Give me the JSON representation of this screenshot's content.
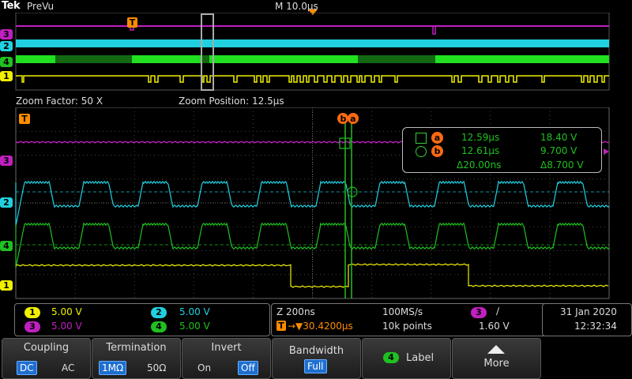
{
  "header": {
    "logo": "Tek",
    "mode": "PreVu",
    "horizontal_scale": "M 10.0µs"
  },
  "overview": {
    "channel_markers": [
      "3",
      "2",
      "4",
      "1"
    ],
    "trigger_marker": "T"
  },
  "zoom": {
    "factor_label": "Zoom Factor: 50 X",
    "position_label": "Zoom Position: 12.5µs"
  },
  "main": {
    "trigger_marker": "T",
    "cursor_tag": "ba",
    "channel_markers": [
      "3",
      "2",
      "4",
      "1"
    ]
  },
  "cursor_readout": {
    "a_badge": "a",
    "b_badge": "b",
    "a_time": "12.59µs",
    "a_value": "18.40 V",
    "b_time": "12.61µs",
    "b_value": "9.700 V",
    "delta_time": "Δ20.00ns",
    "delta_value": "Δ8.700 V"
  },
  "channels": [
    {
      "id": "1",
      "scale": "5.00 V",
      "color": "#f0f000"
    },
    {
      "id": "2",
      "scale": "5.00 V",
      "color": "#20d0e0"
    },
    {
      "id": "3",
      "scale": "5.00 V",
      "color": "#c020c0"
    },
    {
      "id": "4",
      "scale": "5.00 V",
      "color": "#20c020"
    }
  ],
  "acquisition": {
    "zoom_timebase": "Z 200ns",
    "trigger_position": "→▼30.4200µs",
    "sample_rate": "100MS/s",
    "record_length": "10k points",
    "trigger_channel": "3",
    "trigger_slope": "∕",
    "trigger_level": "1.60 V"
  },
  "datetime": {
    "date": "31 Jan  2020",
    "time": "12:32:34"
  },
  "softkeys": {
    "coupling": {
      "title": "Coupling",
      "opt1": "DC",
      "opt2": "AC"
    },
    "termination": {
      "title": "Termination",
      "opt1": "1MΩ",
      "opt2": "50Ω"
    },
    "invert": {
      "title": "Invert",
      "opt1": "On",
      "opt2": "Off"
    },
    "bandwidth": {
      "title": "Bandwidth",
      "value": "Full"
    },
    "label": {
      "badge": "4",
      "title": "Label"
    },
    "more": {
      "title": "More"
    }
  },
  "colors": {
    "ch1": "#f0f000",
    "ch2": "#20d0e0",
    "ch3": "#c020c0",
    "ch4": "#20c020",
    "trigger": "#ff8c00",
    "cursor": "#20c020",
    "selected_option": "#1e6fd0"
  }
}
